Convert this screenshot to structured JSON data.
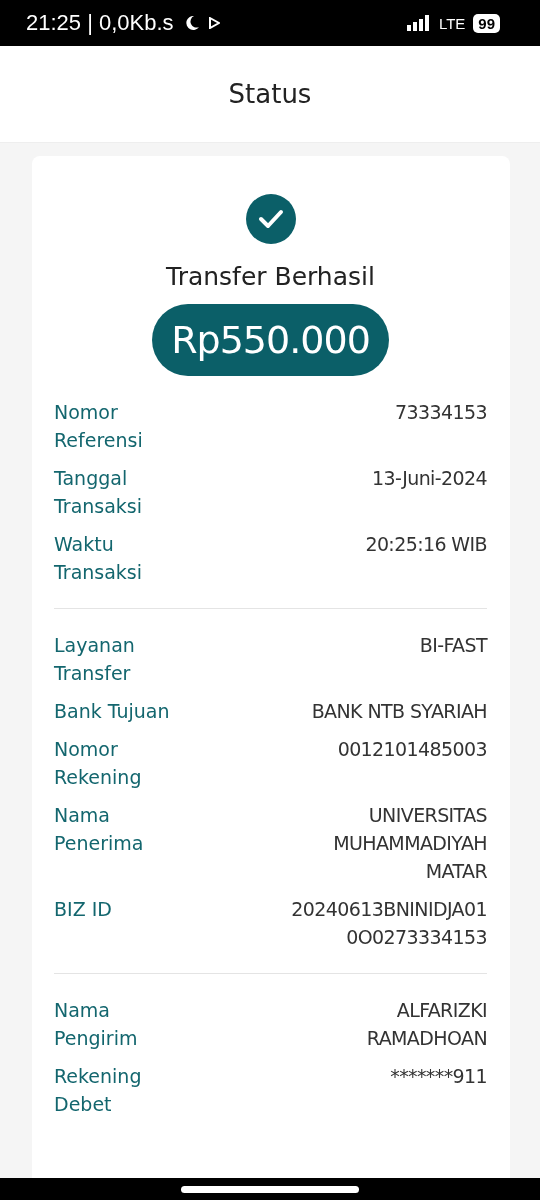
{
  "status_bar": {
    "time": "21:25 | 0,0Kb.s",
    "network": "LTE",
    "battery": "99"
  },
  "header": {
    "title": "Status"
  },
  "result": {
    "title": "Transfer Berhasil",
    "amount": "Rp550.000"
  },
  "sections": [
    {
      "rows": [
        {
          "label": "Nomor\nReferensi",
          "value": "73334153"
        },
        {
          "label": "Tanggal\nTransaksi",
          "value": "13-Juni-2024"
        },
        {
          "label": "Waktu\nTransaksi",
          "value": "20:25:16 WIB"
        }
      ]
    },
    {
      "rows": [
        {
          "label": "Layanan\nTransfer",
          "value": "BI-FAST"
        },
        {
          "label": "Bank Tujuan",
          "value": "BANK NTB SYARIAH"
        },
        {
          "label": "Nomor\nRekening",
          "value": "0012101485003"
        },
        {
          "label": "Nama\nPenerima",
          "value": "UNIVERSITAS\nMUHAMMADIYAH\nMATAR"
        },
        {
          "label": "BIZ ID",
          "value": "20240613BNINIDJA01\n0O0273334153"
        }
      ]
    },
    {
      "rows": [
        {
          "label": "Nama\nPengirim",
          "value": "ALFARIZKI\nRAMADHOAN"
        },
        {
          "label": "Rekening\nDebet",
          "value": "*******911"
        }
      ]
    }
  ]
}
